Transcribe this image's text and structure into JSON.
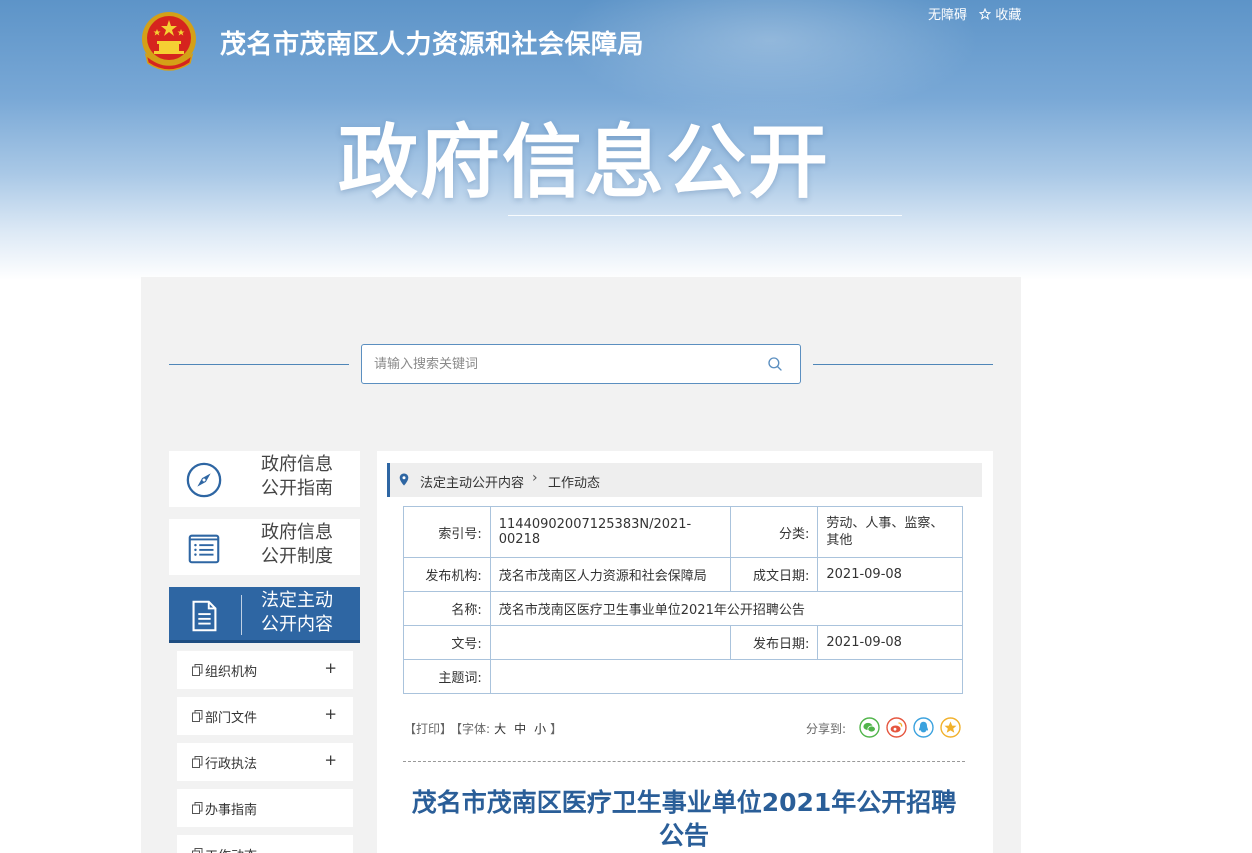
{
  "header": {
    "site_title": "茂名市茂南区人力资源和社会保障局",
    "big_title": "政府信息公开",
    "accessibility_link": "无障碍",
    "favorite_link": "收藏"
  },
  "search": {
    "placeholder": "请输入搜索关键词"
  },
  "nav": {
    "cards": [
      {
        "line1": "政府信息",
        "line2": "公开指南",
        "icon": "compass-icon"
      },
      {
        "line1": "政府信息",
        "line2": "公开制度",
        "icon": "list-document-icon"
      },
      {
        "line1": "法定主动",
        "line2": "公开内容",
        "icon": "document-icon",
        "active": true
      }
    ],
    "sub_items": [
      {
        "label": "组织机构",
        "expand": "+"
      },
      {
        "label": "部门文件",
        "expand": "+"
      },
      {
        "label": "行政执法",
        "expand": "+"
      },
      {
        "label": "办事指南",
        "expand": ""
      },
      {
        "label": "工作动态",
        "expand": ""
      }
    ]
  },
  "breadcrumb": {
    "level1": "法定主动公开内容",
    "separator": "›",
    "level2": "工作动态"
  },
  "meta": {
    "index_key": "索引号:",
    "index_value": "11440902007125383N/2021-00218",
    "category_key": "分类:",
    "category_value": "劳动、人事、监察、其他",
    "publisher_key": "发布机构:",
    "publisher_value": "茂名市茂南区人力资源和社会保障局",
    "created_key": "成文日期:",
    "created_value": "2021-09-08",
    "name_key": "名称:",
    "name_value": "茂名市茂南区医疗卫生事业单位2021年公开招聘公告",
    "docno_key": "文号:",
    "docno_value": "",
    "published_key": "发布日期:",
    "published_value": "2021-09-08",
    "subject_key": "主题词:",
    "subject_value": ""
  },
  "tools": {
    "print": "【打印】",
    "font_prefix": "【字体:",
    "font_large": "大",
    "font_medium": "中",
    "font_small": "小",
    "font_suffix": "】",
    "share_label": "分享到:"
  },
  "colors": {
    "primary_blue": "#2e66a3",
    "title_blue": "#2a5e98",
    "wechat_green": "#51b54b",
    "weibo_red": "#e5563f",
    "qq_blue": "#3ba2de",
    "favorite_gold": "#f1b12c"
  },
  "article": {
    "title": "茂名市茂南区医疗卫生事业单位2021年公开招聘公告"
  }
}
